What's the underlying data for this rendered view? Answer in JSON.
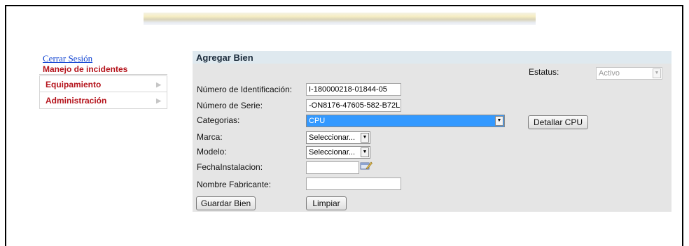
{
  "sidebar": {
    "logout_link": "Cerrar Sesión",
    "section_title": "Manejo de incidentes",
    "items": [
      {
        "label": "Equipamiento",
        "arrow": "▶"
      },
      {
        "label": "Administración",
        "arrow": "▶"
      }
    ]
  },
  "form": {
    "title": "Agregar Bien",
    "status": {
      "label": "Estatus:",
      "value": "Activo"
    },
    "id_number": {
      "label": "Número de Identificación:",
      "value": "I-180000218-01844-05"
    },
    "serial_number": {
      "label": "Número de Serie:",
      "value": "-ON8176-47605-582-B72L"
    },
    "category": {
      "label": "Categorias:",
      "value": "CPU"
    },
    "detail_button": "Detallar CPU",
    "brand": {
      "label": "Marca:",
      "value": "Seleccionar..."
    },
    "model": {
      "label": "Modelo:",
      "value": "Seleccionar..."
    },
    "install_date": {
      "label": "FechaInstalacion:",
      "value": ""
    },
    "manufacturer": {
      "label": "Nombre Fabricante:",
      "value": ""
    },
    "save_button": "Guardar Bien",
    "clear_button": "Limpiar"
  },
  "icons": {
    "calendar": "calendar-icon",
    "dropdown": "chevron-down-icon"
  },
  "colors": {
    "sidebar_accent": "#b5141c",
    "link": "#0b3fd1",
    "panel_header": "#dfe9ef",
    "panel": "#e5e5e5",
    "selected": "#3399ff"
  }
}
